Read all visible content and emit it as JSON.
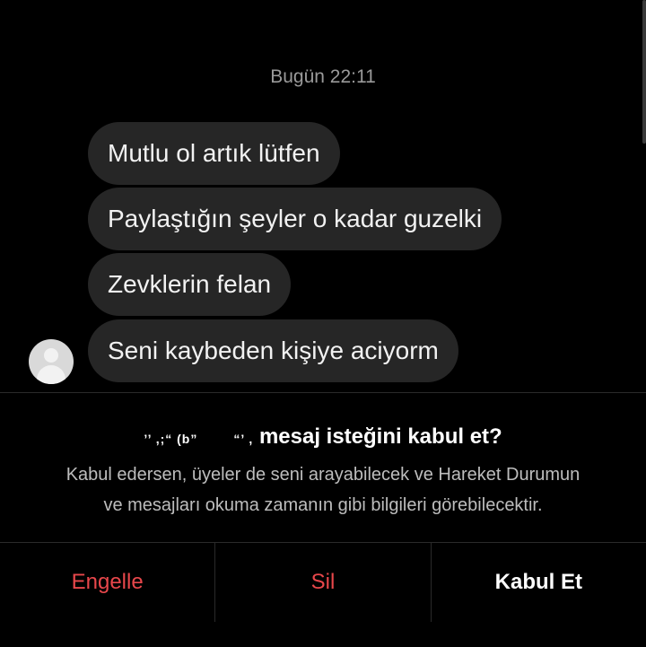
{
  "conversation": {
    "timestamp": "Bugün 22:11",
    "messages": [
      "Mutlu ol artık lütfen",
      "Paylaştığın şeyler o kadar guzelki",
      "Zevklerin felan",
      "Seni kaybeden kişiye aciyorm"
    ]
  },
  "request": {
    "title_prefix": "’’ ,;“ (b”",
    "title_mid": "“’ ,",
    "title": "mesaj isteğini kabul et?",
    "body_line1": "Kabul edersen, üyeler de seni arayabilecek ve Hareket Durumun",
    "body_line2": "ve mesajları okuma zamanın gibi bilgileri görebilecektir."
  },
  "actions": {
    "block_label": "Engelle",
    "delete_label": "Sil",
    "accept_label": "Kabul Et"
  },
  "colors": {
    "background": "#000000",
    "bubble": "#262626",
    "destructive": "#e8474b",
    "secondary_text": "#bdbdbd"
  }
}
